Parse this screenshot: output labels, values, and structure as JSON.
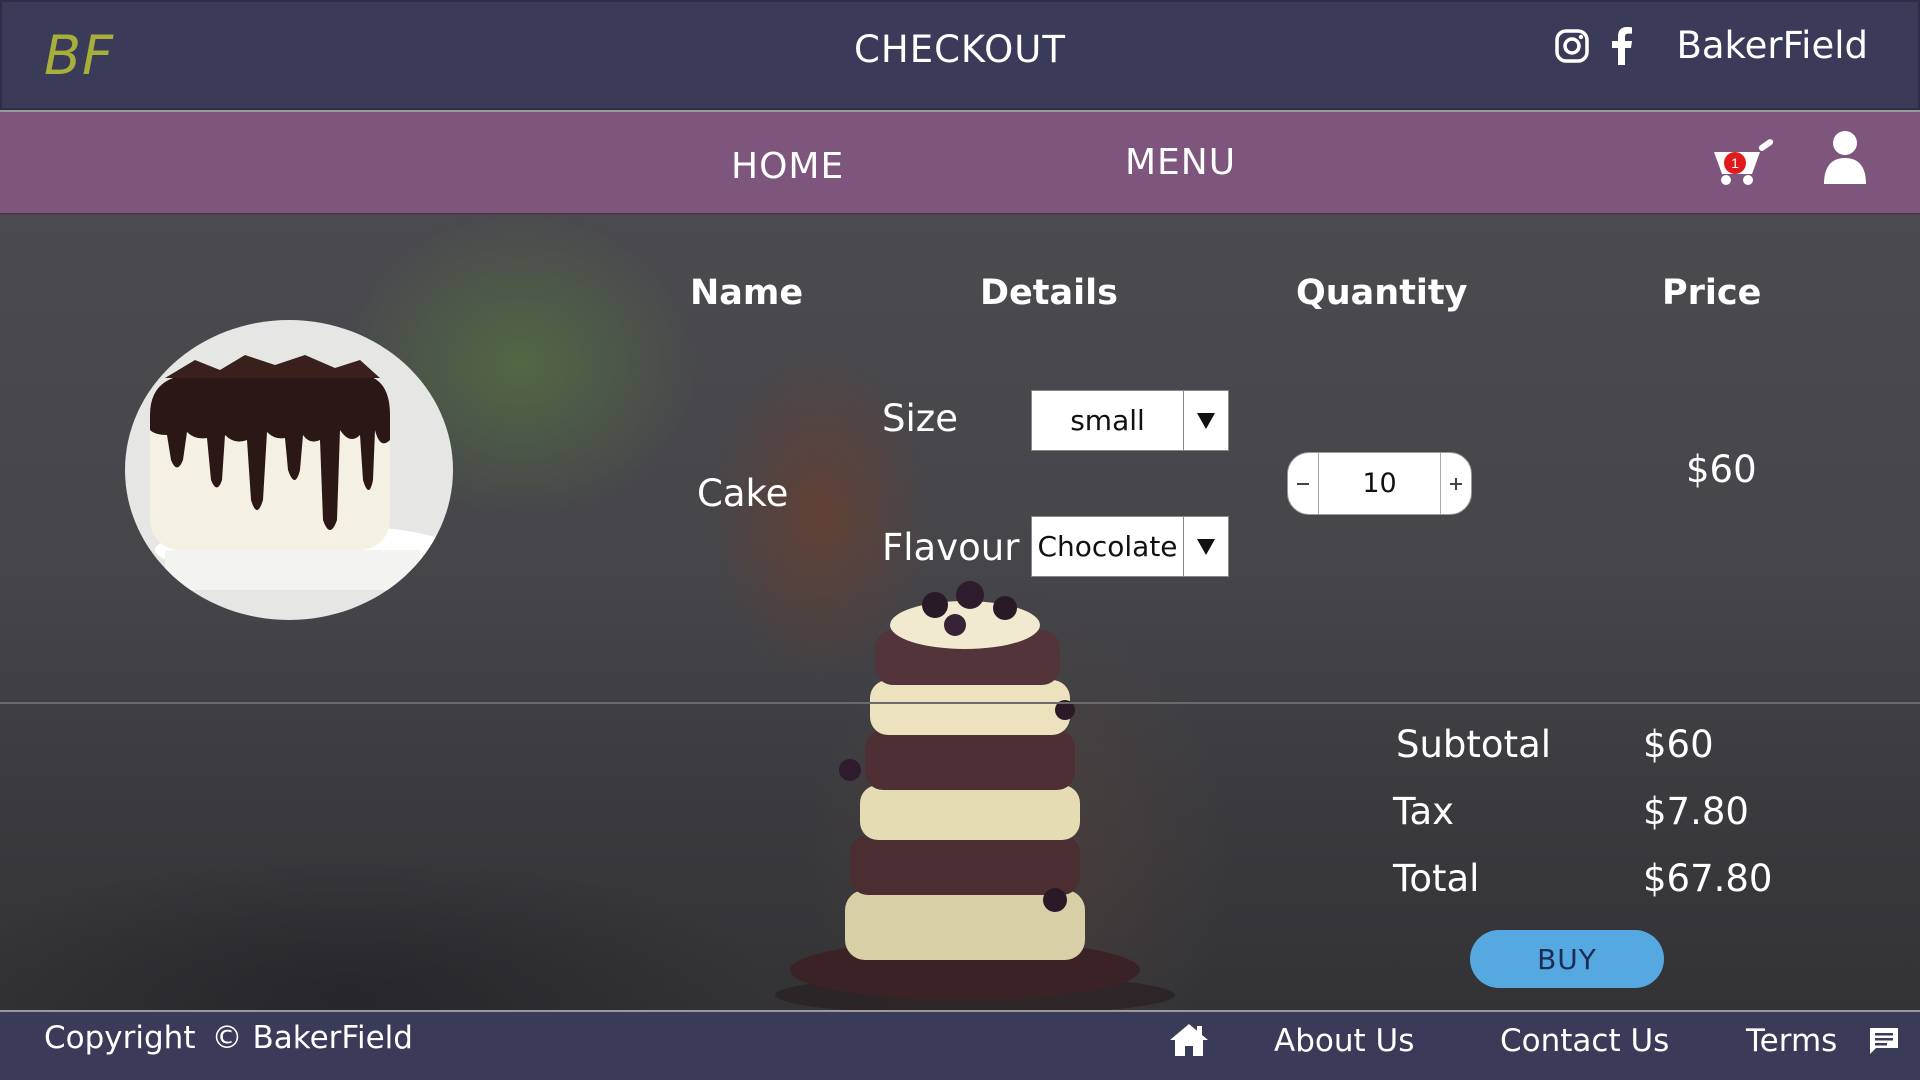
{
  "header": {
    "logo": "BF",
    "title": "CHECKOUT",
    "brand": "BakerField",
    "icons": [
      "instagram-icon",
      "facebook-icon"
    ]
  },
  "nav": {
    "home": "HOME",
    "menu": "MENU",
    "cart_count": "1",
    "icons": [
      "cart-icon",
      "user-icon"
    ]
  },
  "table": {
    "headers": {
      "name": "Name",
      "details": "Details",
      "quantity": "Quantity",
      "price": "Price"
    },
    "item": {
      "name": "Cake",
      "size_label": "Size",
      "size_value": "small",
      "flavour_label": "Flavour",
      "flavour_value": "Chocolate",
      "quantity": "10",
      "price": "$60"
    }
  },
  "summary": {
    "subtotal_label": "Subtotal",
    "subtotal": "$60",
    "tax_label": "Tax",
    "tax": "$7.80",
    "total_label": "Total",
    "total": "$67.80",
    "buy_label": "BUY"
  },
  "footer": {
    "copyright_text": "Copyright",
    "copyright_symbol": "©",
    "copyright_owner": "BakerField",
    "about": "About Us",
    "contact": "Contact Us",
    "terms": "Terms",
    "icons": [
      "home-icon",
      "chat-icon"
    ]
  },
  "colors": {
    "header_bg": "#3a3a59",
    "nav_bg": "#7d557d",
    "logo": "#a8ae3a",
    "buy_button": "#55a9e0",
    "badge": "#e01b1b"
  }
}
